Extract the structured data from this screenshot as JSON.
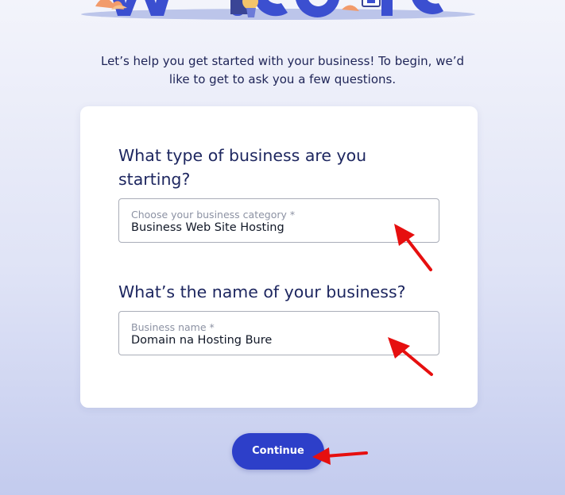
{
  "header": {
    "intro_line1": "Let’s help you get started with your business! To begin, we’d",
    "intro_line2": "like to get to ask you a few questions."
  },
  "form": {
    "q1": {
      "line1": "What type of business are you",
      "line2": "starting?",
      "label": "Choose your business category *",
      "value": "Business Web Site Hosting"
    },
    "q2": {
      "question": "What’s the name of your business?",
      "label": "Business name *",
      "value": "Domain na Hosting Bure"
    }
  },
  "actions": {
    "continue_label": "Continue"
  },
  "colors": {
    "accent": "#2d3fc9",
    "annotation_arrow": "#e60f0f",
    "heading_text": "#1e2760"
  },
  "icons": [
    "welcome-illustration-icon",
    "annotation-arrow-icon"
  ]
}
